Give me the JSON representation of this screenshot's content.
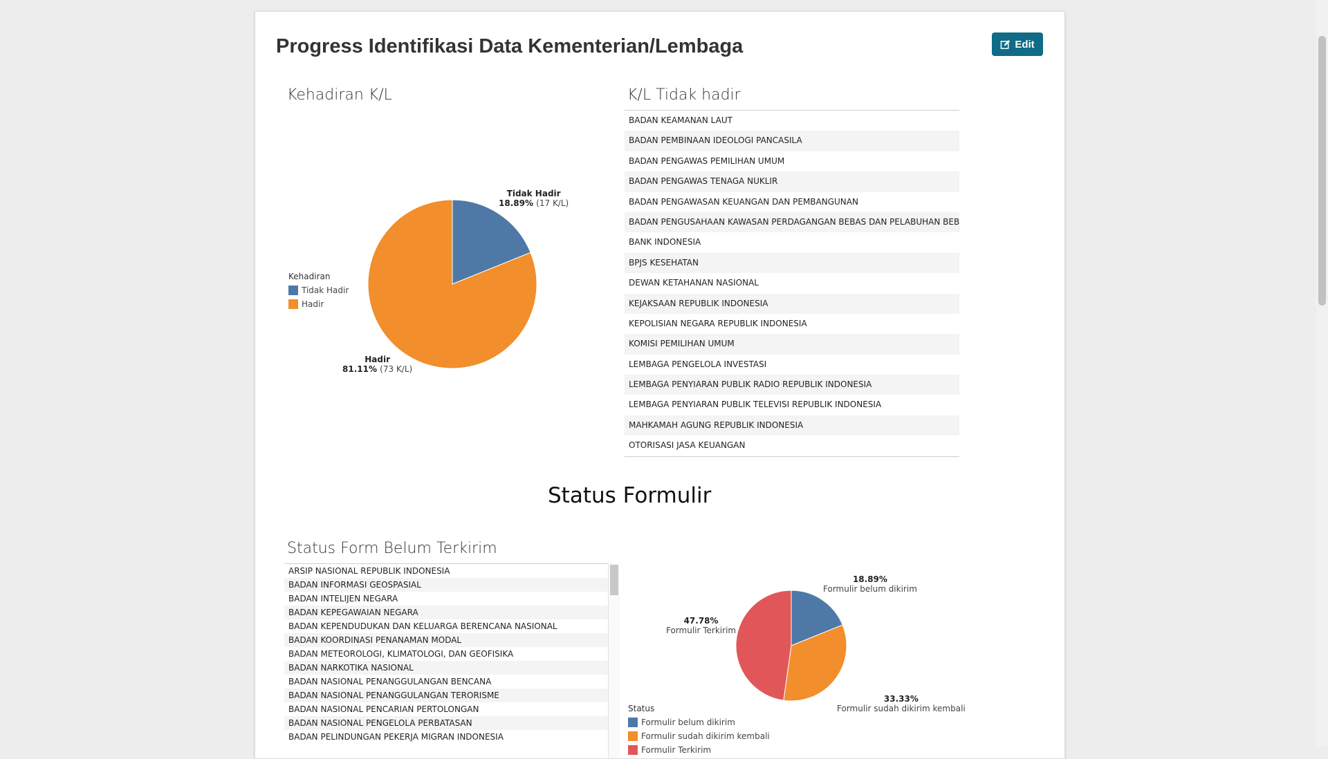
{
  "header": {
    "title": "Progress Identifikasi Data Kementerian/Lembaga",
    "edit_label": "Edit"
  },
  "kehadiran": {
    "title": "Kehadiran K/L",
    "legend_title": "Kehadiran",
    "legend": [
      "Tidak Hadir",
      "Hadir"
    ],
    "labels": {
      "tidak_hadir_name": "Tidak Hadir",
      "tidak_hadir_pct": "18.89%",
      "tidak_hadir_count": "(17 K/L)",
      "hadir_name": "Hadir",
      "hadir_pct": "81.11%",
      "hadir_count": "(73 K/L)"
    },
    "colors": {
      "tidak_hadir": "#4e79a7",
      "hadir": "#f28e2b"
    }
  },
  "tidak_hadir_list": {
    "title": "K/L Tidak hadir",
    "items": [
      "BADAN KEAMANAN LAUT",
      "BADAN PEMBINAAN IDEOLOGI PANCASILA",
      "BADAN PENGAWAS PEMILIHAN UMUM",
      "BADAN PENGAWAS TENAGA NUKLIR",
      "BADAN PENGAWASAN KEUANGAN DAN PEMBANGUNAN",
      "BADAN PENGUSAHAAN KAWASAN PERDAGANGAN BEBAS DAN PELABUHAN BEBAS SA",
      "BANK INDONESIA",
      "BPJS KESEHATAN",
      "DEWAN KETAHANAN NASIONAL",
      "KEJAKSAAN REPUBLIK INDONESIA",
      "KEPOLISIAN NEGARA REPUBLIK INDONESIA",
      "KOMISI PEMILIHAN UMUM",
      "LEMBAGA PENGELOLA INVESTASI",
      "LEMBAGA PENYIARAN PUBLIK RADIO REPUBLIK INDONESIA",
      "LEMBAGA PENYIARAN PUBLIK TELEVISI REPUBLIK INDONESIA",
      "MAHKAMAH AGUNG REPUBLIK INDONESIA",
      "OTORISASI JASA KEUANGAN"
    ]
  },
  "status_formulir": {
    "title": "Status Formulir"
  },
  "belum_terkirim_list": {
    "title": "Status Form Belum Terkirim",
    "items": [
      "ARSIP NASIONAL REPUBLIK INDONESIA",
      "BADAN INFORMASI GEOSPASIAL",
      "BADAN INTELIJEN NEGARA",
      "BADAN KEPEGAWAIAN NEGARA",
      "BADAN KEPENDUDUKAN DAN KELUARGA BERENCANA NASIONAL",
      "BADAN KOORDINASI PENANAMAN MODAL",
      "BADAN METEOROLOGI, KLIMATOLOGI, DAN GEOFISIKA",
      "BADAN NARKOTIKA NASIONAL",
      "BADAN NASIONAL PENANGGULANGAN BENCANA",
      "BADAN NASIONAL PENANGGULANGAN TERORISME",
      "BADAN NASIONAL PENCARIAN PERTOLONGAN",
      "BADAN NASIONAL PENGELOLA PERBATASAN",
      "BADAN PELINDUNGAN PEKERJA MIGRAN INDONESIA"
    ]
  },
  "status_pie": {
    "legend_title": "Status",
    "legend": [
      "Formulir belum dikirim",
      "Formulir sudah dikirim kembali",
      "Formulir Terkirim"
    ],
    "labels": {
      "belum_pct": "18.89%",
      "belum_name": "Formulir belum dikirim",
      "sudah_pct": "33.33%",
      "sudah_name": "Formulir sudah dikirim kembali",
      "terkirim_pct": "47.78%",
      "terkirim_name": "Formulir Terkirim"
    },
    "colors": {
      "belum": "#4e79a7",
      "sudah": "#f28e2b",
      "terkirim": "#e15759"
    }
  },
  "chart_data": [
    {
      "type": "pie",
      "categories": [
        "Tidak Hadir",
        "Hadir"
      ],
      "values": [
        18.89,
        81.11
      ],
      "counts": [
        17,
        73
      ],
      "title": "Kehadiran K/L",
      "legend_position": "left"
    },
    {
      "type": "pie",
      "categories": [
        "Formulir belum dikirim",
        "Formulir sudah dikirim kembali",
        "Formulir Terkirim"
      ],
      "values": [
        18.89,
        33.33,
        47.78
      ],
      "title": "",
      "legend_position": "bottom-left"
    }
  ]
}
